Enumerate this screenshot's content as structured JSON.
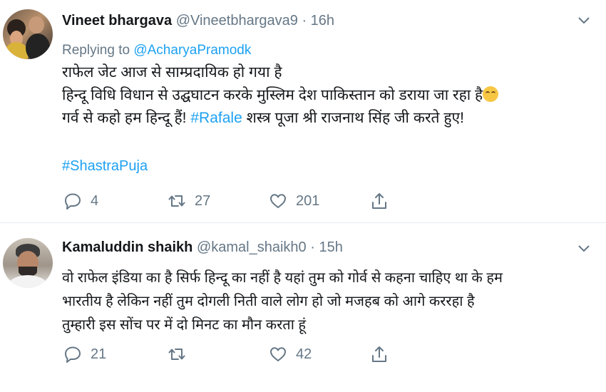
{
  "tweets": [
    {
      "name": "Vineet bhargava",
      "handle": "@Vineetbhargava9",
      "dot": "·",
      "time": "16h",
      "replying_prefix": "Replying to",
      "replying_to": "@AcharyaPramodk",
      "lines": [
        "राफेल जेट आज से साम्प्रदायिक हो गया है",
        "हिन्दू विधि विधान से उद्घघाटन करके मुस्लिम देश पाकिस्तान को डराया जा रहा है",
        "गर्व से कहो हम हिन्दू हैं!",
        "#Rafale",
        "शस्त्र पूजा श्री राजनाथ सिंह जी करते हुए!"
      ],
      "hashtag_line": "#ShastraPuja",
      "stats": {
        "replies": "4",
        "retweets": "27",
        "likes": "201"
      }
    },
    {
      "name": "Kamaluddin shaikh",
      "handle": "@kamal_shaikh0",
      "dot": "·",
      "time": "15h",
      "lines": [
        "वो राफेल इंडिया का है सिर्फ हिन्दू का नहीं है यहां तुम को गोर्व से कहना चाहिए था के हम",
        "भारतीय है लेकिन नहीं तुम दोगली निती वाले लोग हो जो मजहब को आगे कररहा है",
        "तुम्हारी इस सोंच पर में दो मिनट का मौन करता हूं"
      ],
      "stats": {
        "replies": "21",
        "retweets": "",
        "likes": "42"
      }
    }
  ],
  "colors": {
    "link": "#1da1f2",
    "muted": "#657786",
    "text": "#14171a",
    "divider": "#e6ecf0",
    "emoji": "#f7c744"
  },
  "icons": [
    "reply-icon",
    "retweet-icon",
    "like-icon",
    "share-icon",
    "chevron-down-icon",
    "laughing-tears-emoji"
  ]
}
